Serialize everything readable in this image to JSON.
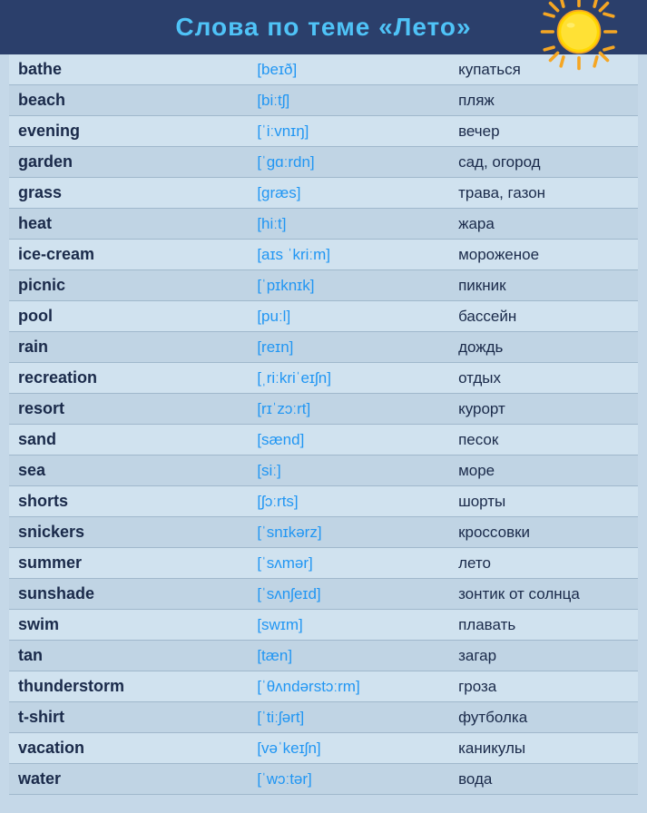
{
  "header": {
    "title": "Слова по теме «Лето»"
  },
  "words": [
    {
      "word": "bathe",
      "phonetic": "[beɪð]",
      "translation": "купаться"
    },
    {
      "word": "beach",
      "phonetic": "[biːtʃ]",
      "translation": "пляж"
    },
    {
      "word": "evening",
      "phonetic": "[ˈiːvnɪŋ]",
      "translation": "вечер"
    },
    {
      "word": "garden",
      "phonetic": "[ˈɡɑːrdn]",
      "translation": "сад, огород"
    },
    {
      "word": "grass",
      "phonetic": "[ɡræs]",
      "translation": "трава, газон"
    },
    {
      "word": "heat",
      "phonetic": "[hiːt]",
      "translation": "жара"
    },
    {
      "word": "ice-cream",
      "phonetic": "[aɪs ˈkriːm]",
      "translation": "мороженое"
    },
    {
      "word": "picnic",
      "phonetic": "[ˈpɪknɪk]",
      "translation": "пикник"
    },
    {
      "word": "pool",
      "phonetic": "[puːl]",
      "translation": "бассейн"
    },
    {
      "word": "rain",
      "phonetic": "[reɪn]",
      "translation": "дождь"
    },
    {
      "word": "recreation",
      "phonetic": "[ˌriːkriˈeɪʃn]",
      "translation": "отдых"
    },
    {
      "word": "resort",
      "phonetic": "[rɪˈzɔːrt]",
      "translation": "курорт"
    },
    {
      "word": "sand",
      "phonetic": "[sænd]",
      "translation": "песок"
    },
    {
      "word": "sea",
      "phonetic": "[siː]",
      "translation": "море"
    },
    {
      "word": "shorts",
      "phonetic": "[ʃɔːrts]",
      "translation": "шорты"
    },
    {
      "word": "snickers",
      "phonetic": "[ˈsnɪkərz]",
      "translation": "кроссовки"
    },
    {
      "word": "summer",
      "phonetic": "[ˈsʌmər]",
      "translation": "лето"
    },
    {
      "word": "sunshade",
      "phonetic": "[ˈsʌnʃeɪd]",
      "translation": "зонтик от солнца"
    },
    {
      "word": "swim",
      "phonetic": "[swɪm]",
      "translation": "плавать"
    },
    {
      "word": "tan",
      "phonetic": "[tæn]",
      "translation": "загар"
    },
    {
      "word": "thunderstorm",
      "phonetic": "[ˈθʌndərstɔːrm]",
      "translation": "гроза"
    },
    {
      "word": "t-shirt",
      "phonetic": "[ˈtiːʃərt]",
      "translation": "футболка"
    },
    {
      "word": "vacation",
      "phonetic": "[vəˈkeɪʃn]",
      "translation": "каникулы"
    },
    {
      "word": "water",
      "phonetic": "[ˈwɔːtər]",
      "translation": "вода"
    }
  ]
}
